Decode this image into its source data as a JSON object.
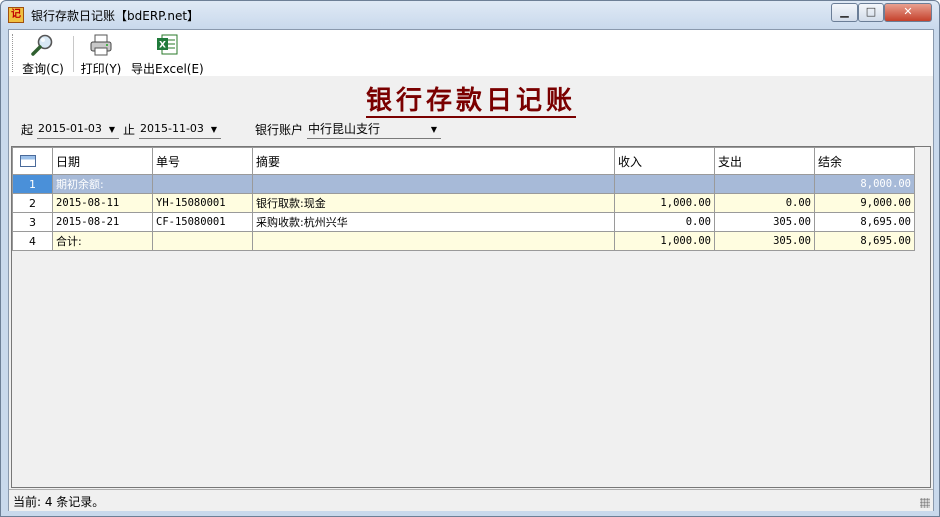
{
  "window": {
    "title": "银行存款日记账【bdERP.net】",
    "icon_label": "记"
  },
  "toolbar": {
    "query_label": "查询(C)",
    "print_label": "打印(Y)",
    "export_label": "导出Excel(E)"
  },
  "report": {
    "title": "银行存款日记账"
  },
  "filter": {
    "from_label": "起",
    "from_value": "2015-01-03",
    "to_label": "止",
    "to_value": "2015-11-03",
    "account_label": "银行账户",
    "account_value": "中行昆山支行"
  },
  "grid": {
    "columns": [
      "日期",
      "单号",
      "摘要",
      "收入",
      "支出",
      "结余"
    ],
    "rows": [
      {
        "index": "1",
        "date": "期初余额:",
        "doc_no": "",
        "summary": "",
        "income": "",
        "expense": "",
        "balance": "8,000.00"
      },
      {
        "index": "2",
        "date": "2015-08-11",
        "doc_no": "YH-15080001",
        "summary": "银行取款:现金",
        "income": "1,000.00",
        "expense": "0.00",
        "balance": "9,000.00"
      },
      {
        "index": "3",
        "date": "2015-08-21",
        "doc_no": "CF-15080001",
        "summary": "采购收款:杭州兴华",
        "income": "0.00",
        "expense": "305.00",
        "balance": "8,695.00"
      },
      {
        "index": "4",
        "date": "合计:",
        "doc_no": "",
        "summary": "",
        "income": "1,000.00",
        "expense": "305.00",
        "balance": "8,695.00"
      }
    ]
  },
  "status": {
    "text": "当前: 4 条记录。"
  },
  "colors": {
    "title_color": "#7a0000",
    "selected_row": "#a7bad8",
    "alt_row": "#fffde0"
  }
}
